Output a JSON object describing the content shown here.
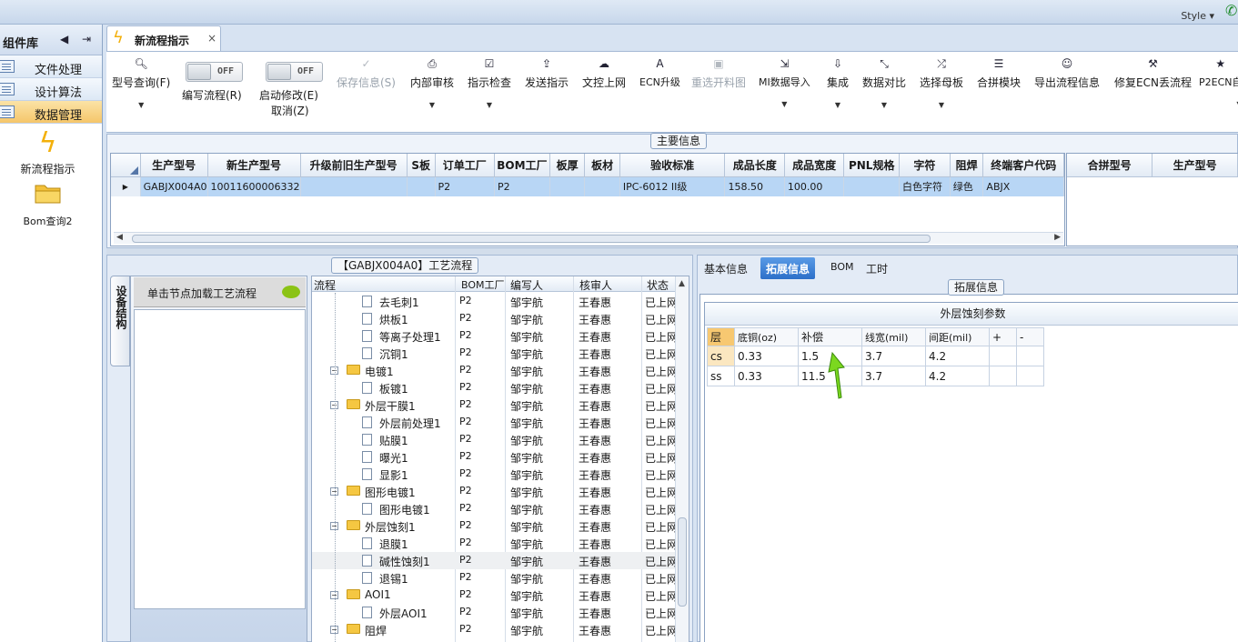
{
  "topbar": {
    "style_label": "Style",
    "chevron": "▾"
  },
  "left_panel": {
    "title": "组件库",
    "items": [
      {
        "label": "文件处理"
      },
      {
        "label": "设计算法"
      },
      {
        "label": "数据管理"
      }
    ],
    "tools": [
      {
        "label": "新流程指示",
        "icon": "lightning-icon"
      },
      {
        "label": "Bom查询2",
        "icon": "folder-icon"
      }
    ]
  },
  "doc_tab": {
    "title": "新流程指示",
    "close": "×"
  },
  "toolbar": {
    "model_query": "型号查询(F)",
    "edit_flow": "编写流程(R)",
    "start_modify": "启动修改(E)",
    "cancel": "取消(Z)",
    "off_label": "OFF",
    "save_info": "保存信息(S)",
    "internal_review": "内部审核",
    "instruction_check": "指示检查",
    "send_instruction": "发送指示",
    "upload_control": "文控上网",
    "ecn_upgrade": "ECN升级",
    "redraw": "重选开料图",
    "mi_import": "MI数据导入",
    "integrate": "集成",
    "data_compare": "数据对比",
    "select_master": "选择母板",
    "merge_module": "合拼模块",
    "export_flow": "导出流程信息",
    "fix_ecn": "修复ECN丢流程",
    "p2ecn": "P2ECN自"
  },
  "main_info": {
    "caption": "主要信息",
    "columns": [
      "生产型号",
      "新生产型号",
      "升级前旧生产型号",
      "S板",
      "订单工厂",
      "BOM工厂",
      "板厚",
      "板材",
      "验收标准",
      "成品长度",
      "成品宽度",
      "PNL规格",
      "字符",
      "阻焊",
      "终端客户代码"
    ],
    "row": [
      "GABJX004A0",
      "10011600006332",
      "",
      "",
      "P2",
      "P2",
      "",
      "",
      "IPC-6012 II级",
      "158.50",
      "100.00",
      "",
      "白色字符",
      "绿色",
      "ABJX"
    ],
    "side_columns": [
      "合拼型号",
      "生产型号"
    ]
  },
  "process": {
    "caption": "【GABJX004A0】工艺流程",
    "vtab": "设备结构",
    "node_hint": "单击节点加载工艺流程",
    "columns": [
      "流程",
      "BOM工厂",
      "编写人",
      "核审人",
      "状态"
    ],
    "rows": [
      {
        "name": "去毛刺1",
        "level": 2,
        "factory": "P2",
        "writer": "邹宇航",
        "reviewer": "王春惠",
        "status": "已上网"
      },
      {
        "name": "烘板1",
        "level": 2,
        "factory": "P2",
        "writer": "邹宇航",
        "reviewer": "王春惠",
        "status": "已上网"
      },
      {
        "name": "等离子处理1",
        "level": 2,
        "factory": "P2",
        "writer": "邹宇航",
        "reviewer": "王春惠",
        "status": "已上网"
      },
      {
        "name": "沉铜1",
        "level": 2,
        "factory": "P2",
        "writer": "邹宇航",
        "reviewer": "王春惠",
        "status": "已上网"
      },
      {
        "name": "电镀1",
        "level": 1,
        "factory": "P2",
        "writer": "邹宇航",
        "reviewer": "王春惠",
        "status": "已上网"
      },
      {
        "name": "板镀1",
        "level": 2,
        "factory": "P2",
        "writer": "邹宇航",
        "reviewer": "王春惠",
        "status": "已上网"
      },
      {
        "name": "外层干膜1",
        "level": 1,
        "factory": "P2",
        "writer": "邹宇航",
        "reviewer": "王春惠",
        "status": "已上网"
      },
      {
        "name": "外层前处理1",
        "level": 2,
        "factory": "P2",
        "writer": "邹宇航",
        "reviewer": "王春惠",
        "status": "已上网"
      },
      {
        "name": "贴膜1",
        "level": 2,
        "factory": "P2",
        "writer": "邹宇航",
        "reviewer": "王春惠",
        "status": "已上网"
      },
      {
        "name": "曝光1",
        "level": 2,
        "factory": "P2",
        "writer": "邹宇航",
        "reviewer": "王春惠",
        "status": "已上网"
      },
      {
        "name": "显影1",
        "level": 2,
        "factory": "P2",
        "writer": "邹宇航",
        "reviewer": "王春惠",
        "status": "已上网"
      },
      {
        "name": "图形电镀1",
        "level": 1,
        "factory": "P2",
        "writer": "邹宇航",
        "reviewer": "王春惠",
        "status": "已上网"
      },
      {
        "name": "图形电镀1",
        "level": 2,
        "factory": "P2",
        "writer": "邹宇航",
        "reviewer": "王春惠",
        "status": "已上网"
      },
      {
        "name": "外层蚀刻1",
        "level": 1,
        "factory": "P2",
        "writer": "邹宇航",
        "reviewer": "王春惠",
        "status": "已上网"
      },
      {
        "name": "退膜1",
        "level": 2,
        "factory": "P2",
        "writer": "邹宇航",
        "reviewer": "王春惠",
        "status": "已上网"
      },
      {
        "name": "碱性蚀刻1",
        "level": 2,
        "factory": "P2",
        "writer": "邹宇航",
        "reviewer": "王春惠",
        "status": "已上网",
        "selected": true
      },
      {
        "name": "退锡1",
        "level": 2,
        "factory": "P2",
        "writer": "邹宇航",
        "reviewer": "王春惠",
        "status": "已上网"
      },
      {
        "name": "AOI1",
        "level": 1,
        "factory": "P2",
        "writer": "邹宇航",
        "reviewer": "王春惠",
        "status": "已上网"
      },
      {
        "name": "外层AOI1",
        "level": 2,
        "factory": "P2",
        "writer": "邹宇航",
        "reviewer": "王春惠",
        "status": "已上网"
      },
      {
        "name": "阻焊",
        "level": 1,
        "factory": "P2",
        "writer": "邹宇航",
        "reviewer": "王春惠",
        "status": "已上网"
      }
    ]
  },
  "detail": {
    "tabs": [
      "基本信息",
      "拓展信息",
      "BOM",
      "工时"
    ],
    "active_tab": "拓展信息",
    "caption": "拓展信息",
    "table_title": "外层蚀刻参数",
    "columns": [
      "层",
      "底铜(oz)",
      "补偿",
      "线宽(mil)",
      "间距(mil)",
      "+",
      "-"
    ],
    "rows": [
      [
        "cs",
        "0.33",
        "1.5",
        "3.7",
        "4.2",
        "",
        ""
      ],
      [
        "ss",
        "0.33",
        "11.5",
        "3.7",
        "4.2",
        "",
        ""
      ]
    ]
  }
}
